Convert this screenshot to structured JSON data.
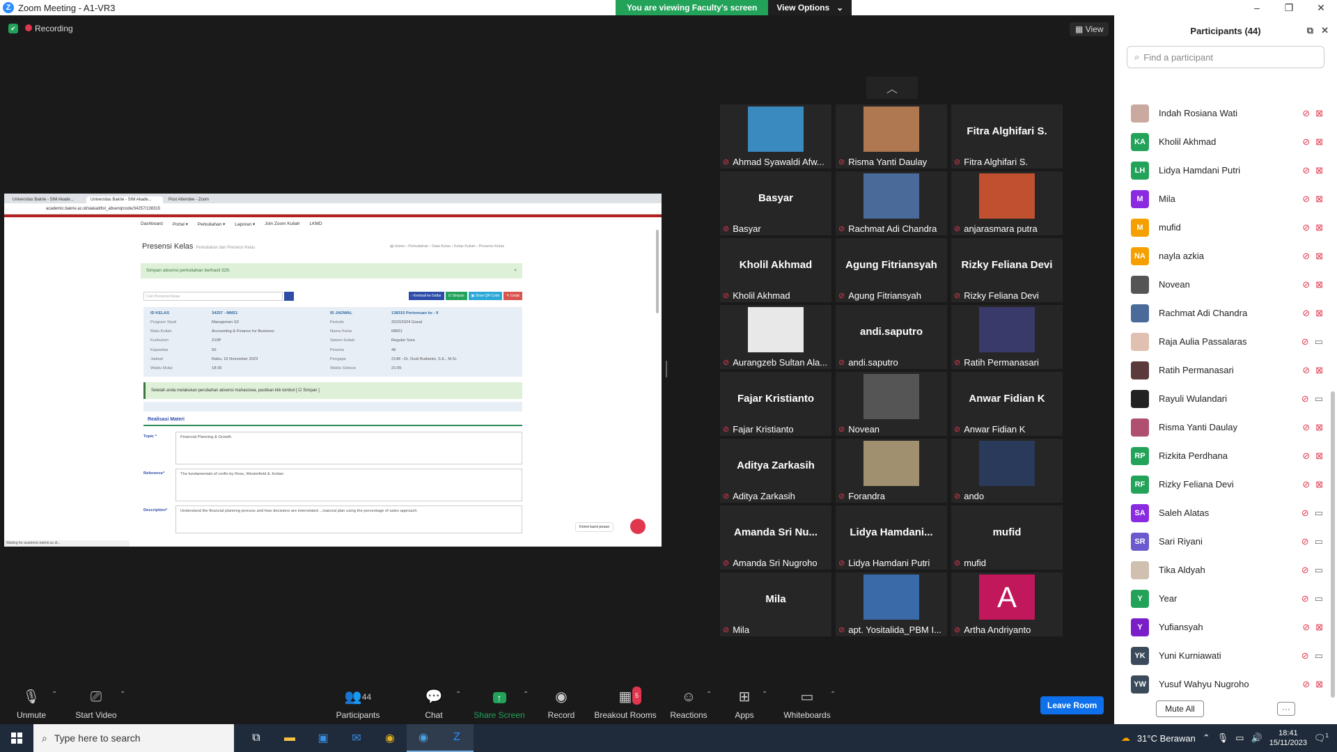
{
  "window": {
    "title": "Zoom Meeting - A1-VR3",
    "logo": "Z"
  },
  "banner": {
    "viewing": "You are viewing Faculty's screen",
    "options": "View Options",
    "caret": "⌄"
  },
  "window_controls": [
    "–",
    "❐",
    "✕"
  ],
  "meeting": {
    "recording": "Recording",
    "view_label": "View",
    "view_icon": "▦"
  },
  "shared_screen": {
    "tabs": [
      "Universitas Bakrie - SIM Akade...",
      "Universitas Bakrie - SIM Akade...",
      "Post Attendee - Zoom"
    ],
    "url": "academic.bakrie.ac.id/siakad/list_absenqrcode/34257/138315",
    "nav": [
      "Dashboard",
      "Portal ▾",
      "Perkuliahan ▾",
      "Laporan ▾",
      "Join Zoom Kuliah",
      "LKMD"
    ],
    "page_title": "Presensi Kelas",
    "page_subtitle": "Perkuliahan dan Presensi Kelas",
    "breadcrumbs": "▤ Home › Perkuliahan › Data Kelas › Kelas Kuliah › Presensi Kelas",
    "alert": "Simpan absensi perkuliahan berhasil 329.",
    "alert_close": "×",
    "search_placeholder": "Cari Presensi Kelas",
    "buttons": [
      {
        "label": "‹ Kembali ke Daftar",
        "color": "#2c4ca8"
      },
      {
        "label": "☑ Simpan",
        "color": "#23a35a"
      },
      {
        "label": "▣ Show QR Code",
        "color": "#2aa8d8"
      },
      {
        "label": "✎ Cetak",
        "color": "#d9534f"
      }
    ],
    "info": [
      [
        "ID KELAS",
        "34257 - MM21",
        "ID JADWAL",
        "138315 Pertemuan ke - 9"
      ],
      [
        "Program Studi",
        "Manajemen S2",
        "Periode",
        "2023/2024 Gasal"
      ],
      [
        "Mata Kuliah",
        "Accounting & Finance for Business",
        "Nama Kelas",
        "MM21"
      ],
      [
        "Kurikulum",
        "210P",
        "Sistem Kuliah",
        "Regular Sore"
      ],
      [
        "Kapasitas",
        "50",
        "Peserta",
        "46"
      ],
      [
        "Jadwal",
        "Rabu, 15 November 2023",
        "Pengajar",
        "2148 - Dr. Dudi Rudianto, S.E., M.Si."
      ],
      [
        "Waktu Mulai",
        "18:35",
        "Waktu Selesai",
        "21:05"
      ]
    ],
    "note": "Setelah anda melakukan perubahan absensi mahasiswa, pastikan klik tombol [ ☑ Simpan ]",
    "section": "Realisasi Materi",
    "fields": [
      {
        "label": "Topic *",
        "value": "Financial Planning & Growth"
      },
      {
        "label": "Reference*",
        "value": "The fundamentals of corfin by Ross, Westerfield & Jordan"
      },
      {
        "label": "Description*",
        "value": "Understand the financial planning process and how decisions are interrelated ...inancial plan using the percentage of sales approach"
      }
    ],
    "chat_pill": "Kirimi kami pesan",
    "status": "Waiting for academic.bakrie.ac.id..."
  },
  "gallery": [
    {
      "name": "Ahmad Syawaldi Afw...",
      "big": "",
      "photo": "#3a8ac0"
    },
    {
      "name": "Risma Yanti Daulay",
      "big": "",
      "photo": "#b07850"
    },
    {
      "name": "Fitra Alghifari S.",
      "big": "Fitra Alghifari S.",
      "photo": ""
    },
    {
      "name": "Basyar",
      "big": "Basyar",
      "photo": ""
    },
    {
      "name": "Rachmat Adi Chandra",
      "big": "",
      "photo": "#4a6a9a"
    },
    {
      "name": "anjarasmara putra",
      "big": "",
      "photo": "#c05030"
    },
    {
      "name": "Kholil Akhmad",
      "big": "Kholil Akhmad",
      "photo": ""
    },
    {
      "name": "Agung Fitriansyah",
      "big": "Agung Fitriansyah",
      "photo": ""
    },
    {
      "name": "Rizky Feliana Devi",
      "big": "Rizky Feliana Devi",
      "photo": ""
    },
    {
      "name": "Aurangzeb Sultan Ala...",
      "big": "",
      "photo": "#e8e8e8"
    },
    {
      "name": "andi.saputro",
      "big": "andi.saputro",
      "photo": ""
    },
    {
      "name": "Ratih Permanasari",
      "big": "",
      "photo": "#3a3a6a"
    },
    {
      "name": "Fajar Kristianto",
      "big": "Fajar Kristianto",
      "photo": ""
    },
    {
      "name": "Novean",
      "big": "",
      "photo": "#555555"
    },
    {
      "name": "Anwar Fidian K",
      "big": "Anwar Fidian K",
      "photo": ""
    },
    {
      "name": "Aditya Zarkasih",
      "big": "Aditya Zarkasih",
      "photo": ""
    },
    {
      "name": "Forandra",
      "big": "",
      "photo": "#a09070"
    },
    {
      "name": "ando",
      "big": "",
      "photo": "#2a3a5a"
    },
    {
      "name": "Amanda Sri Nugroho",
      "big": "Amanda Sri Nu...",
      "photo": ""
    },
    {
      "name": "Lidya Hamdani Putri",
      "big": "Lidya Hamdani...",
      "photo": ""
    },
    {
      "name": "mufid",
      "big": "mufid",
      "photo": ""
    },
    {
      "name": "Mila",
      "big": "Mila",
      "photo": ""
    },
    {
      "name": "apt. Yositalida_PBM I...",
      "big": "",
      "photo": "#3a6aa8"
    },
    {
      "name": "Artha Andriyanto",
      "big": "",
      "photo": "#c0185a",
      "letter": "A"
    }
  ],
  "toolbar": {
    "unmute": "Unmute",
    "start_video": "Start Video",
    "participants": "Participants",
    "participants_count": "44",
    "chat": "Chat",
    "share": "Share Screen",
    "record": "Record",
    "breakout": "Breakout Rooms",
    "breakout_badge": "5",
    "reactions": "Reactions",
    "apps": "Apps",
    "whiteboards": "Whiteboards",
    "leave": "Leave Room"
  },
  "panel": {
    "title": "Participants (44)",
    "search_placeholder": "Find a participant",
    "mute_all": "Mute All",
    "more": "···",
    "rows": [
      {
        "name": "Indah Rosiana Wati",
        "initials": "",
        "color": "#c9a9a0",
        "cam": "off"
      },
      {
        "name": "Kholil Akhmad",
        "initials": "KA",
        "color": "#23a35a",
        "cam": "off"
      },
      {
        "name": "Lidya Hamdani Putri",
        "initials": "LH",
        "color": "#23a35a",
        "cam": "off"
      },
      {
        "name": "Mila",
        "initials": "M",
        "color": "#8a2be2",
        "cam": "off"
      },
      {
        "name": "mufid",
        "initials": "M",
        "color": "#f5a000",
        "cam": "off"
      },
      {
        "name": "nayla azkia",
        "initials": "NA",
        "color": "#f5a000",
        "cam": "off"
      },
      {
        "name": "Novean",
        "initials": "",
        "color": "#555555",
        "cam": "off"
      },
      {
        "name": "Rachmat Adi Chandra",
        "initials": "",
        "color": "#4a6a9a",
        "cam": "off"
      },
      {
        "name": "Raja Aulia Passalaras",
        "initials": "",
        "color": "#e0c0b0",
        "cam": "on"
      },
      {
        "name": "Ratih Permanasari",
        "initials": "",
        "color": "#5a3a3a",
        "cam": "off"
      },
      {
        "name": "Rayuli Wulandari",
        "initials": "",
        "color": "#222222",
        "cam": "on"
      },
      {
        "name": "Risma Yanti Daulay",
        "initials": "",
        "color": "#b05070",
        "cam": "off"
      },
      {
        "name": "Rizkita Perdhana",
        "initials": "RP",
        "color": "#23a35a",
        "cam": "off"
      },
      {
        "name": "Rizky Feliana Devi",
        "initials": "RF",
        "color": "#23a35a",
        "cam": "off"
      },
      {
        "name": "Saleh Alatas",
        "initials": "SA",
        "color": "#8a2be2",
        "cam": "on"
      },
      {
        "name": "Sari Riyani",
        "initials": "SR",
        "color": "#6a5acd",
        "cam": "on"
      },
      {
        "name": "Tika Aldyah",
        "initials": "",
        "color": "#d0c0b0",
        "cam": "on"
      },
      {
        "name": "Year",
        "initials": "Y",
        "color": "#23a35a",
        "cam": "on"
      },
      {
        "name": "Yufiansyah",
        "initials": "Y",
        "color": "#7a1fc8",
        "cam": "off"
      },
      {
        "name": "Yuni Kurniawati",
        "initials": "YK",
        "color": "#3a4a5a",
        "cam": "on"
      },
      {
        "name": "Yusuf Wahyu Nugroho",
        "initials": "YW",
        "color": "#3a4a5a",
        "cam": "off"
      }
    ]
  },
  "taskbar": {
    "search": "Type here to search",
    "weather": "31°C  Berawan",
    "time": "18:41",
    "date": "15/11/2023",
    "notif": "1"
  }
}
